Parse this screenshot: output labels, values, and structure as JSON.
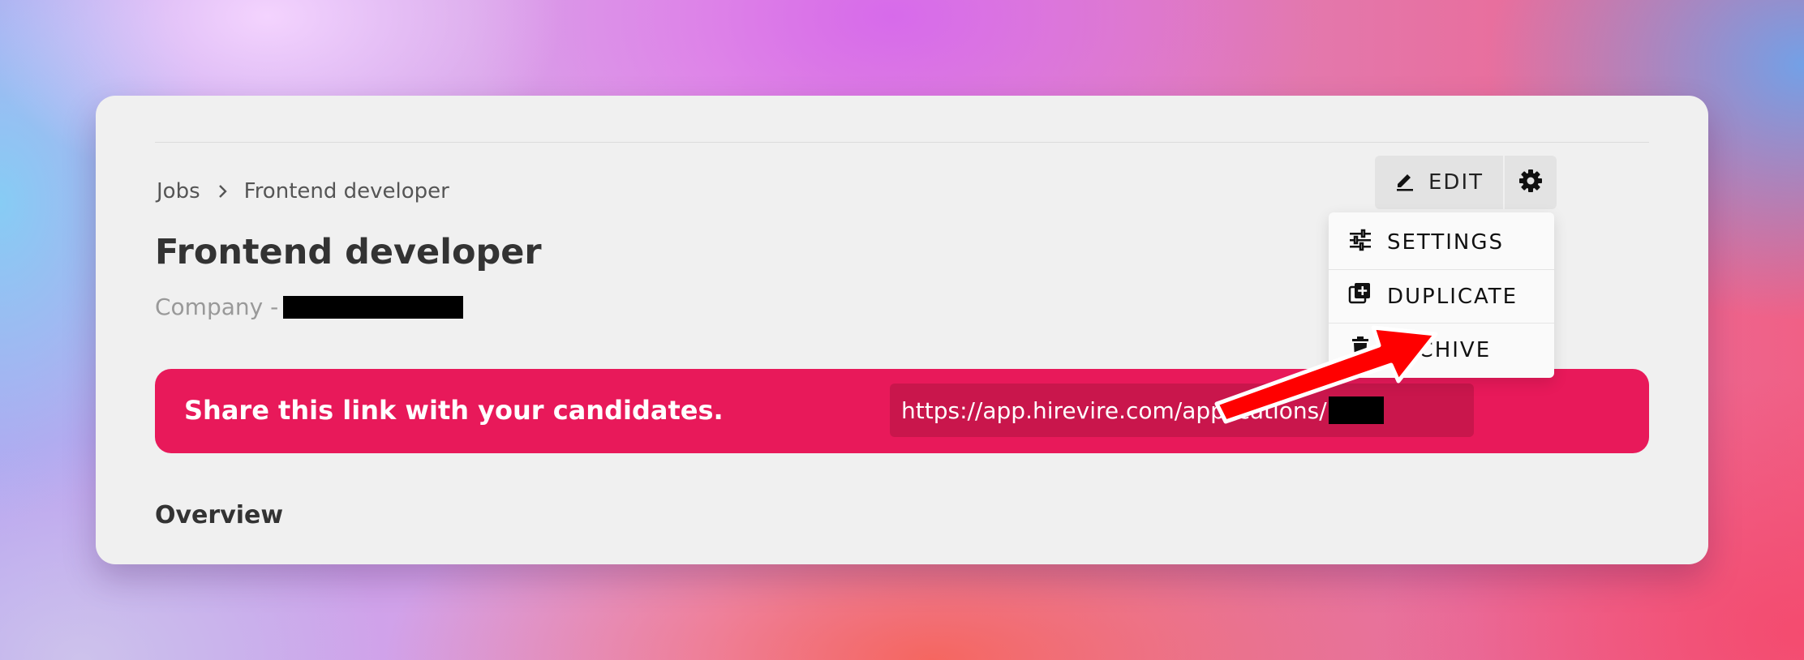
{
  "breadcrumb": {
    "root": "Jobs",
    "current": "Frontend developer"
  },
  "job": {
    "title": "Frontend developer",
    "company_prefix": "Company -"
  },
  "share": {
    "message": "Share this link with your candidates.",
    "url": "https://app.hirevire.com/applications/"
  },
  "section": {
    "overview": "Overview"
  },
  "actions": {
    "edit_label": "EDIT"
  },
  "menu": {
    "items": [
      {
        "label": "SETTINGS",
        "icon": "sliders-icon"
      },
      {
        "label": "DUPLICATE",
        "icon": "duplicate-icon"
      },
      {
        "label": "ARCHIVE",
        "icon": "trash-icon"
      }
    ]
  },
  "colors": {
    "banner": "#e8195a",
    "link_box": "#c9164c",
    "annotation_arrow": "#ff0000",
    "card_bg": "#f0f0f0"
  }
}
